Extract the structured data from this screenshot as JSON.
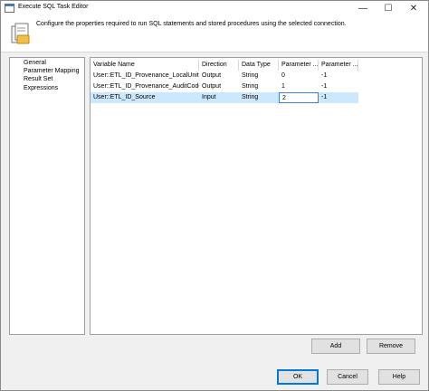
{
  "window": {
    "title": "Execute SQL Task Editor",
    "minimize_glyph": "—",
    "maximize_glyph": "☐",
    "close_glyph": "✕"
  },
  "header": {
    "description": "Configure the properties required to run SQL statements and stored procedures using the selected connection."
  },
  "nav": {
    "items": [
      "General",
      "Parameter Mapping",
      "Result Set",
      "Expressions"
    ]
  },
  "grid": {
    "columns": [
      "Variable Name",
      "Direction",
      "Data Type",
      "Parameter ...",
      "Parameter ..."
    ],
    "rows": [
      [
        "User::ETL_ID_Provenance_LocalUnit...",
        "Output",
        "String",
        "0",
        "-1"
      ],
      [
        "User::ETL_ID_Provenance_AuditCode",
        "Output",
        "String",
        "1",
        "-1"
      ],
      [
        "User::ETL_ID_Source",
        "Input",
        "String",
        "2",
        "-1"
      ]
    ],
    "selected_row": 2
  },
  "buttons": {
    "add": "Add",
    "remove": "Remove",
    "ok": "OK",
    "cancel": "Cancel",
    "help": "Help"
  },
  "icons": [
    "app-icon",
    "task-icon",
    "minimize-icon",
    "maximize-icon",
    "close-icon"
  ],
  "colors": {
    "selection": "#cce8ff",
    "focus_border": "#0078d7"
  }
}
